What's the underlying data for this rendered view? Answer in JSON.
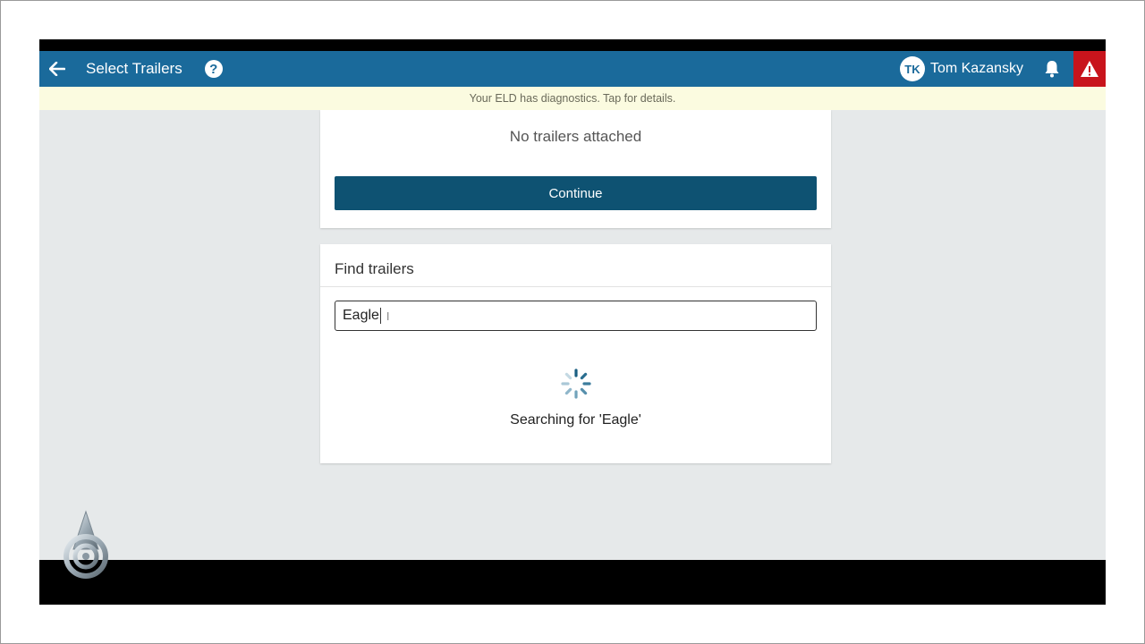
{
  "header": {
    "title": "Select Trailers",
    "user_initials": "TK",
    "user_name": "Tom Kazansky"
  },
  "banner": {
    "text": "Your ELD has diagnostics. Tap for details."
  },
  "status_card": {
    "message": "No trailers attached",
    "continue_label": "Continue"
  },
  "find_card": {
    "title": "Find trailers",
    "search_value": "Eagle",
    "searching_text": "Searching for 'Eagle'"
  },
  "colors": {
    "app_bar": "#1a6a9b",
    "alert": "#c8141c",
    "continue_button": "#0e5272",
    "banner_bg": "#fbfbe0",
    "content_bg": "#e6e9ea"
  }
}
